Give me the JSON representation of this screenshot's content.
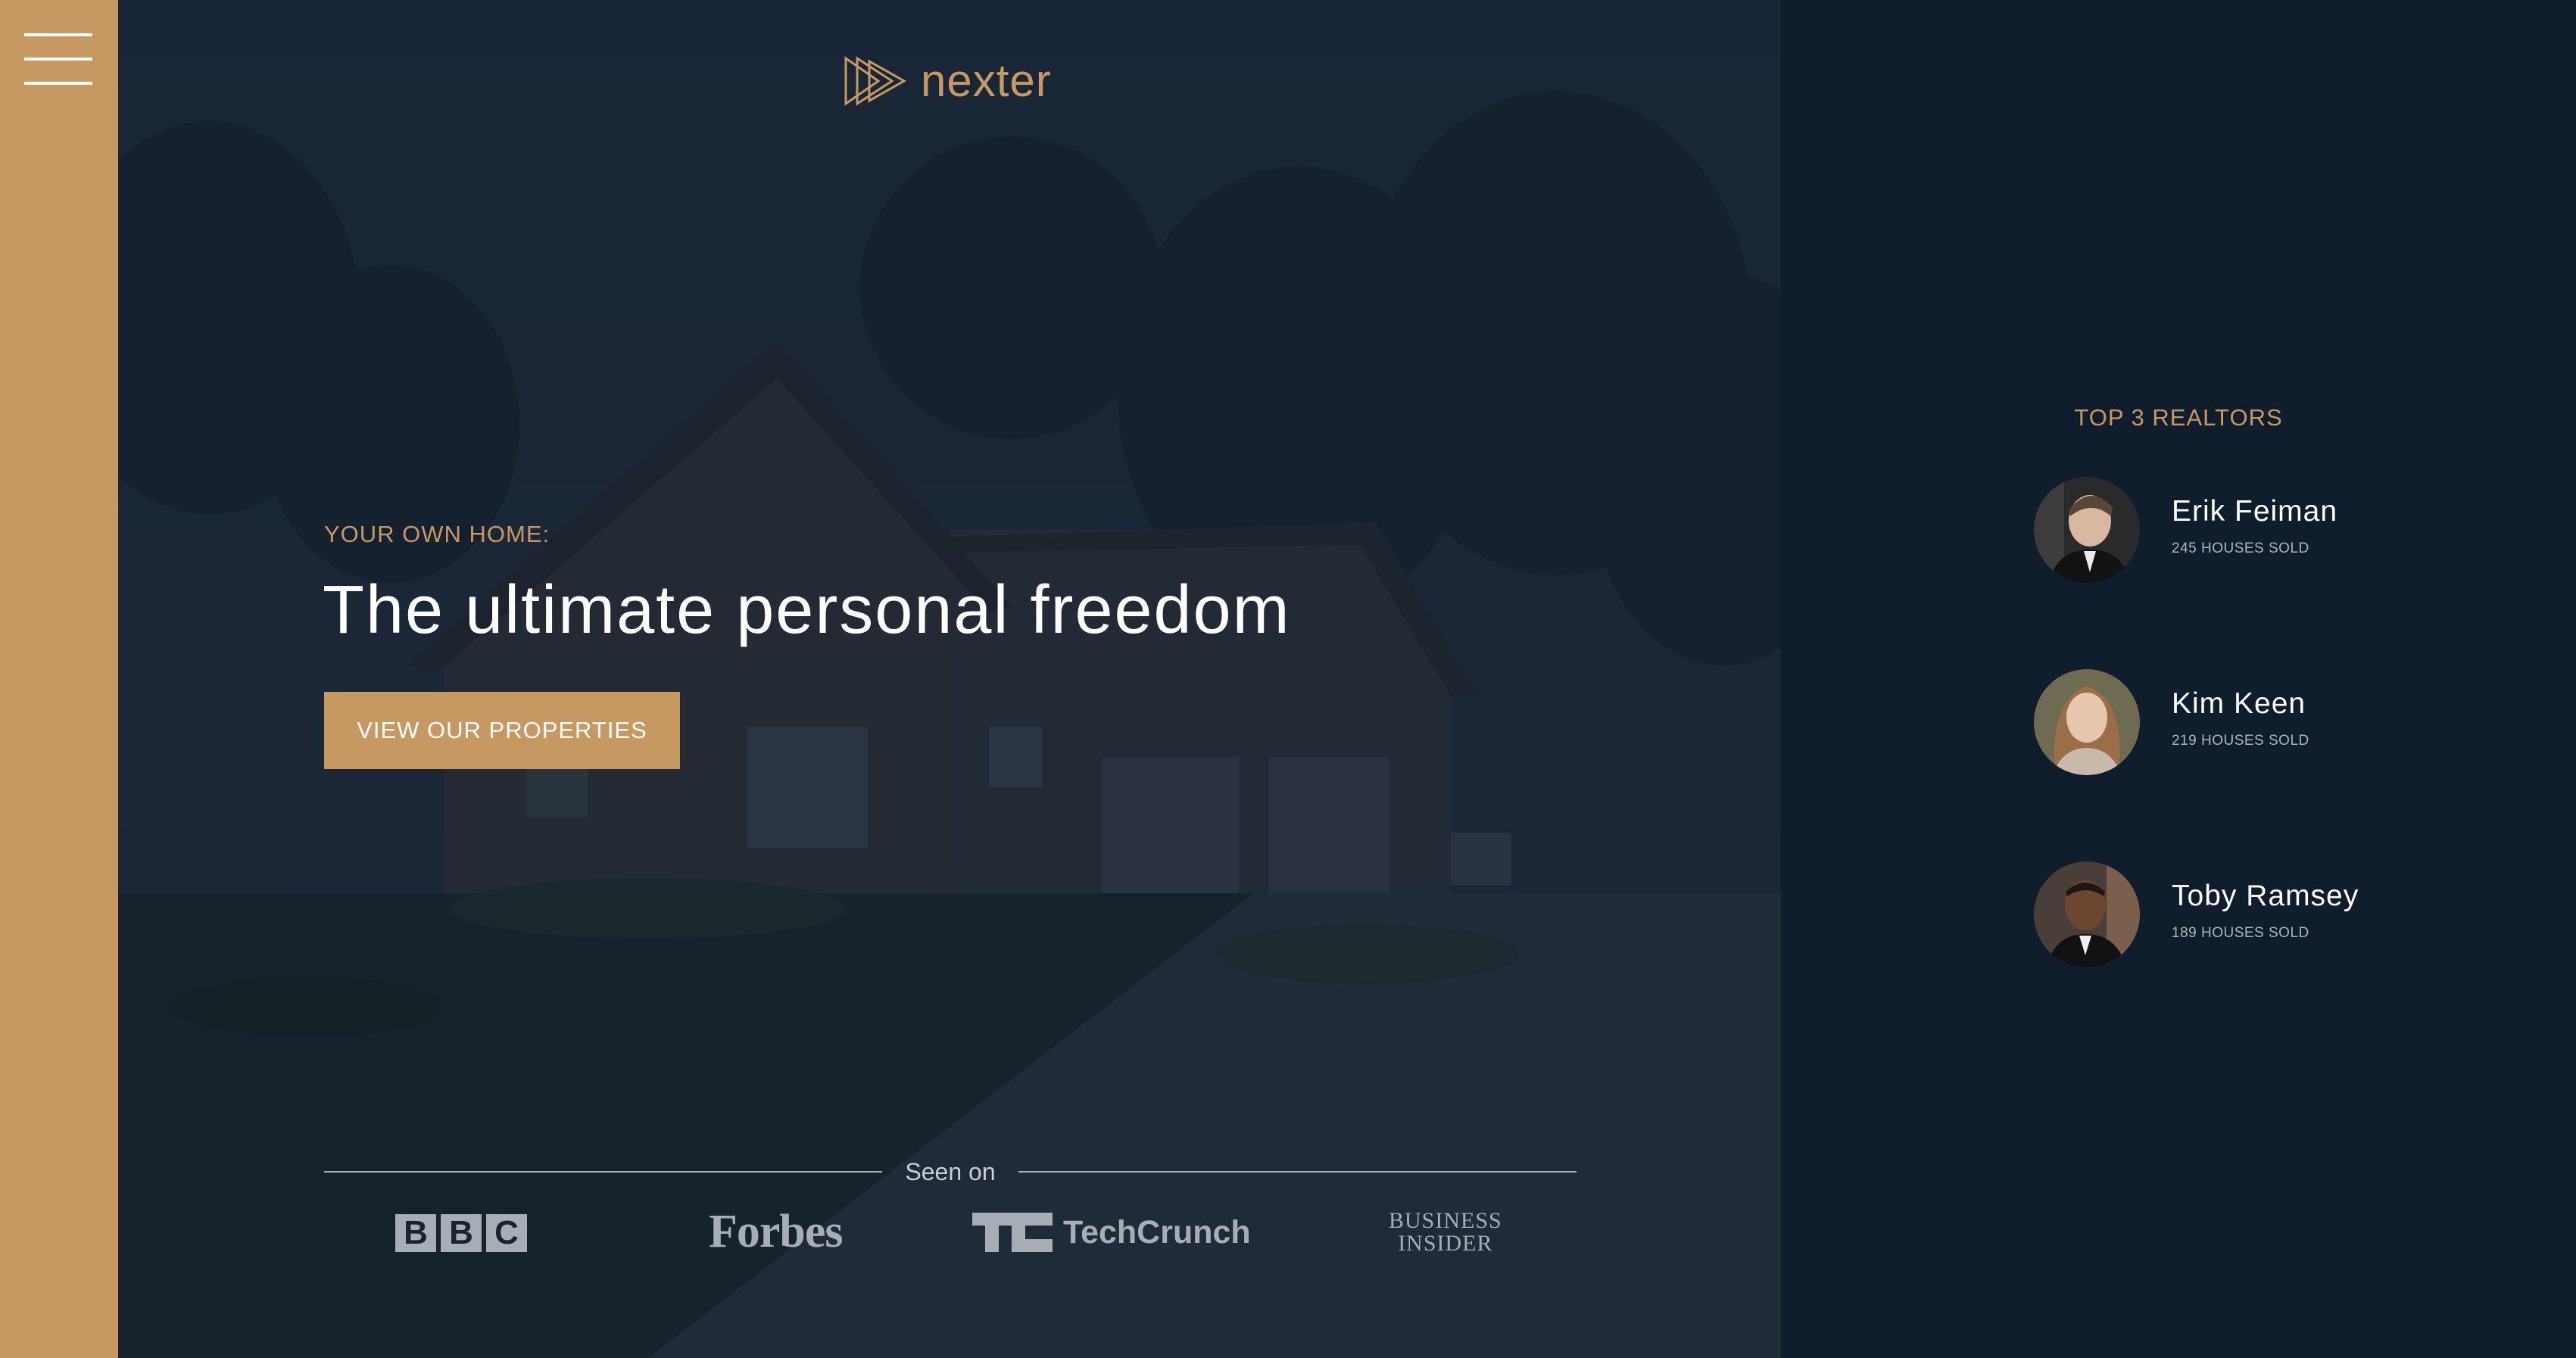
{
  "brand": {
    "name": "nexter",
    "accent": "#c69963",
    "dark": "#101d2c"
  },
  "menu": {
    "icon": "hamburger-menu-icon"
  },
  "hero": {
    "subtitle": "YOUR OWN HOME:",
    "title": "The ultimate personal freedom",
    "cta_label": "VIEW OUR PROPERTIES",
    "background": "house-at-dusk-photo"
  },
  "seen_on": {
    "label": "Seen on",
    "logos": [
      {
        "name": "BBC",
        "letters": [
          "B",
          "B",
          "C"
        ]
      },
      {
        "name": "Forbes"
      },
      {
        "name": "TechCrunch"
      },
      {
        "name": "Business Insider",
        "line1": "BUSINESS",
        "line2": "INSIDER"
      }
    ]
  },
  "realtors": {
    "title": "TOP 3 REALTORS",
    "items": [
      {
        "name": "Erik Feiman",
        "sold": "245 HOUSES SOLD"
      },
      {
        "name": "Kim Keen",
        "sold": "219 HOUSES SOLD"
      },
      {
        "name": "Toby Ramsey",
        "sold": "189 HOUSES SOLD"
      }
    ]
  }
}
